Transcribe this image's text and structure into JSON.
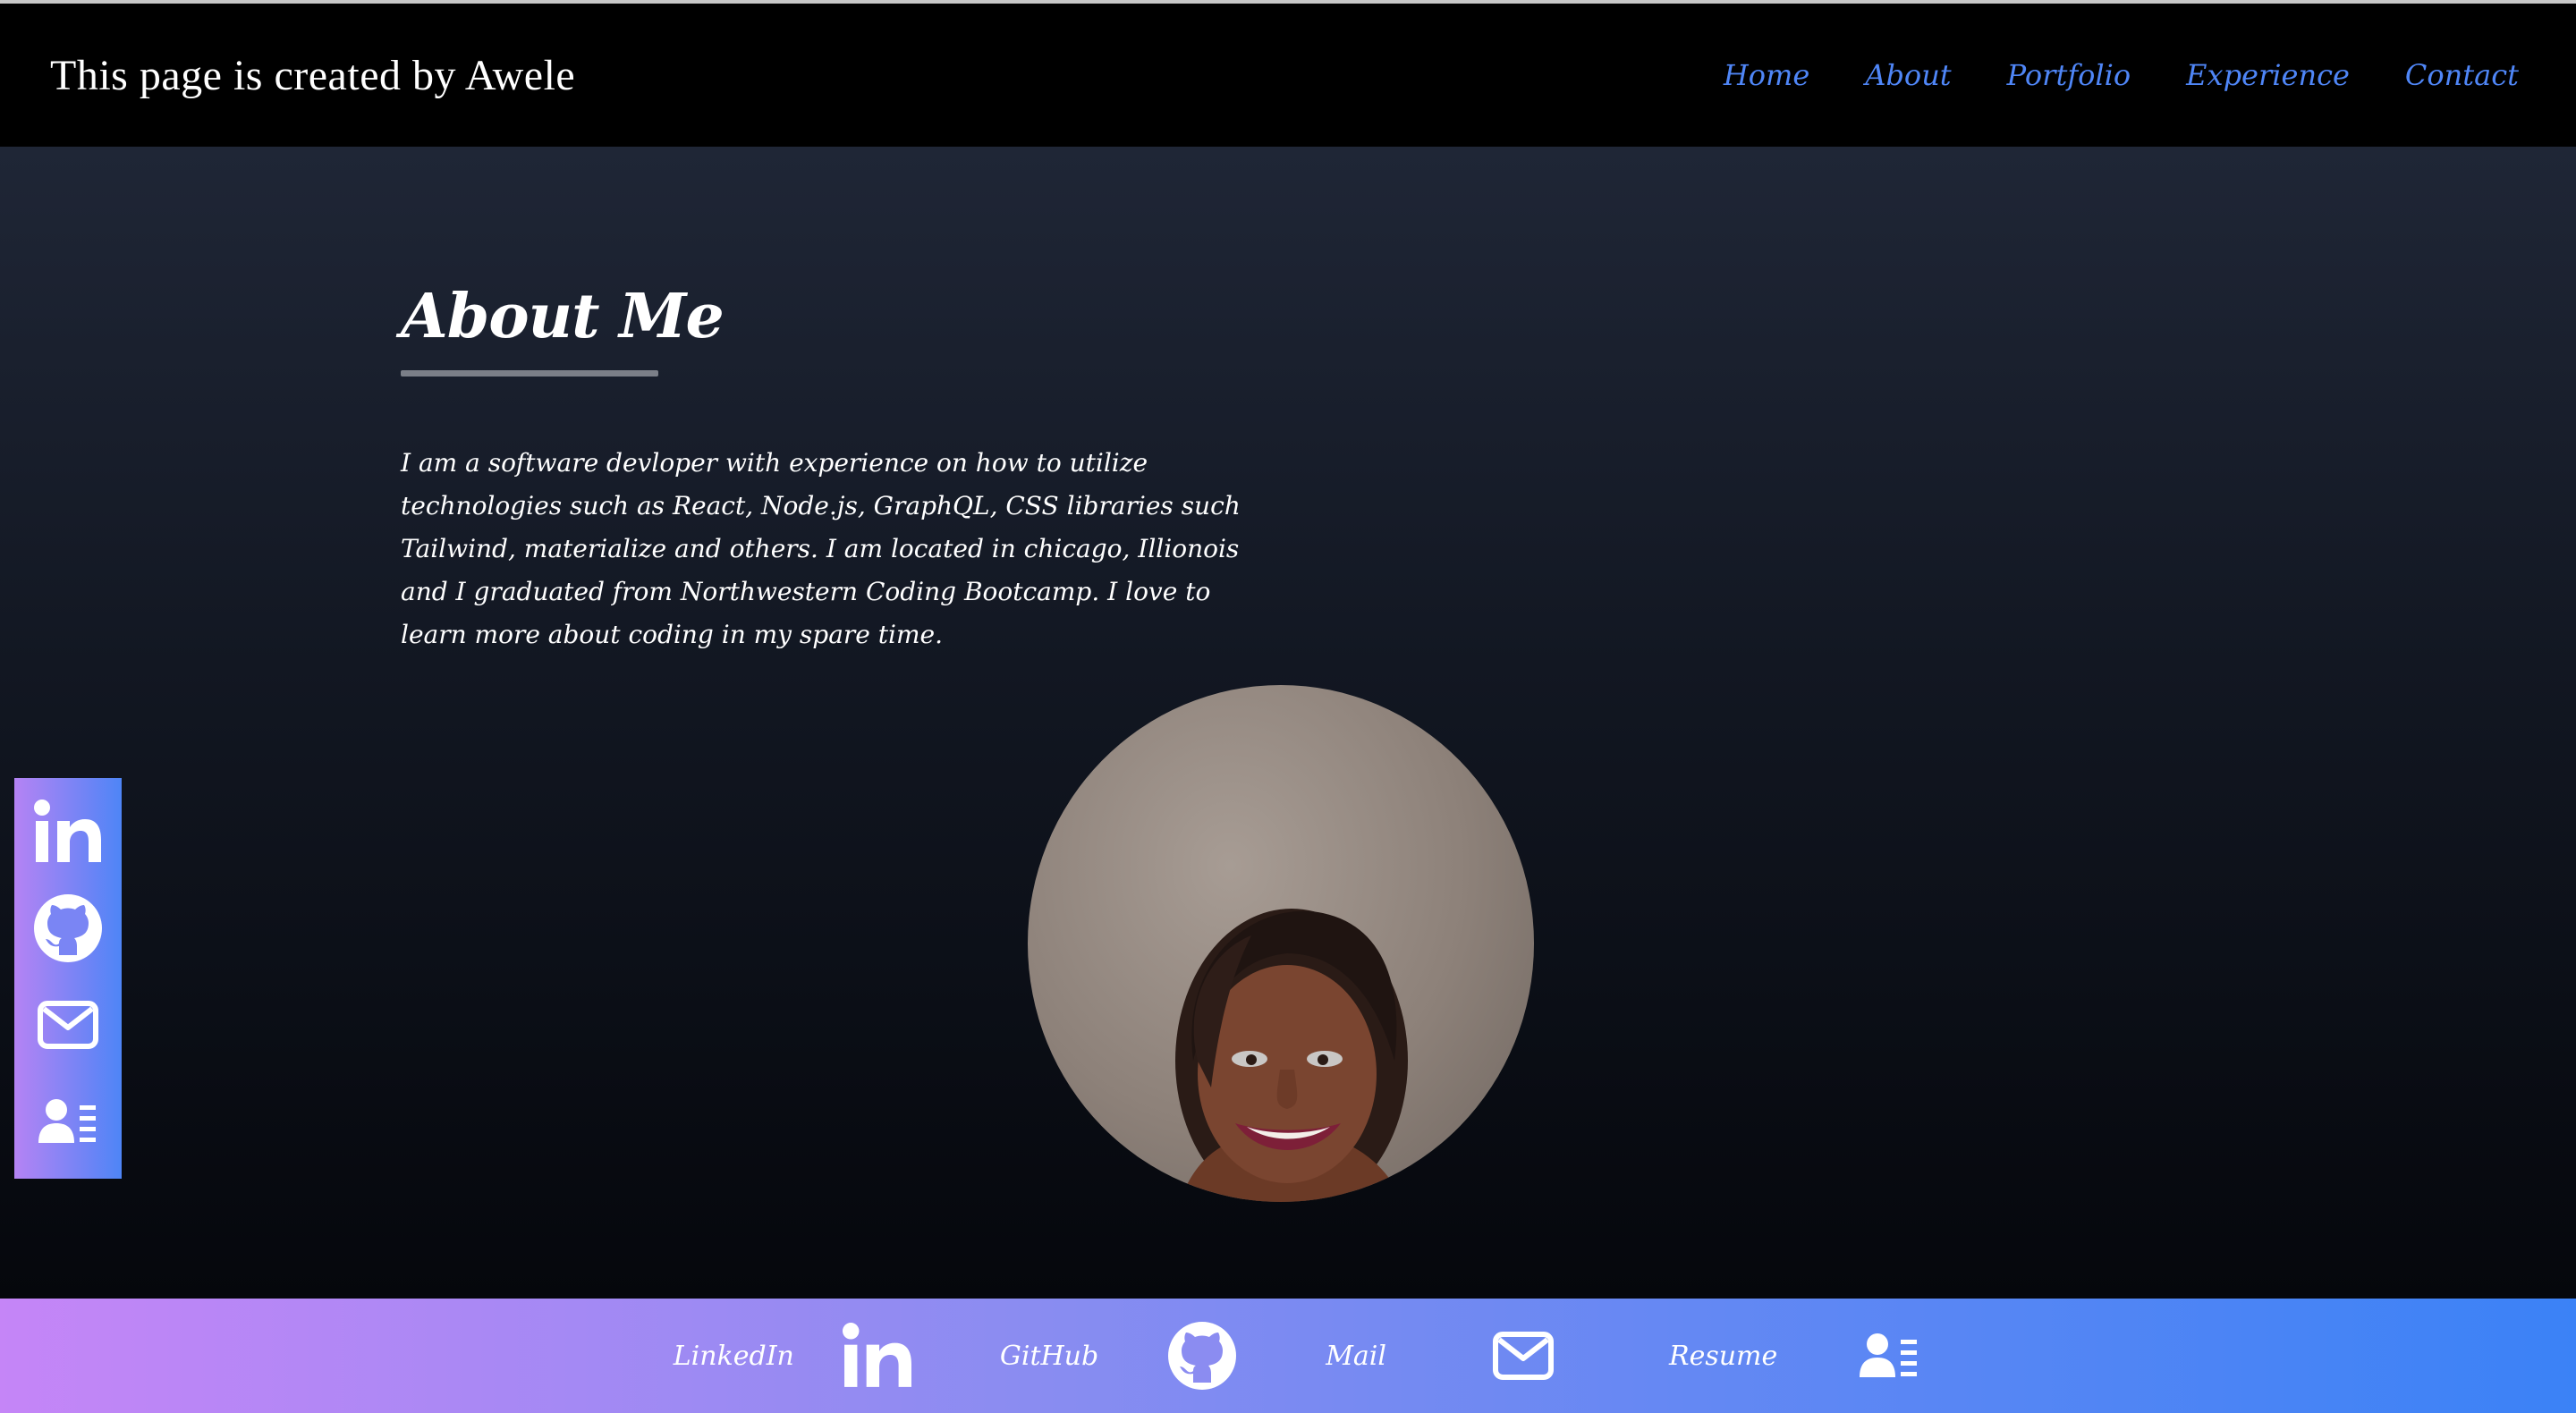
{
  "navbar": {
    "brand": "This page is created by Awele",
    "links": [
      {
        "label": "Home"
      },
      {
        "label": "About"
      },
      {
        "label": "Portfolio"
      },
      {
        "label": "Experience"
      },
      {
        "label": "Contact"
      }
    ]
  },
  "about": {
    "title": "About Me",
    "text": "I am a software devloper with experience on how to utilize technologies such as React, Node.js, GraphQL, CSS libraries such Tailwind, materialize and others. I am located in chicago, Illionois and I graduated from Northwestern Coding Bootcamp. I love to learn more about coding in my spare time."
  },
  "sidebar": {
    "icons": [
      "linkedin-icon",
      "github-icon",
      "mail-icon",
      "resume-icon"
    ]
  },
  "footer": {
    "items": [
      {
        "label": "LinkedIn",
        "icon": "linkedin-icon"
      },
      {
        "label": "GitHub",
        "icon": "github-icon"
      },
      {
        "label": "Mail",
        "icon": "mail-icon"
      },
      {
        "label": "Resume",
        "icon": "resume-icon"
      }
    ]
  },
  "colors": {
    "nav_link": "#4f86f7",
    "gradient_start": "#c585f7",
    "gradient_end": "#3b82f6"
  }
}
